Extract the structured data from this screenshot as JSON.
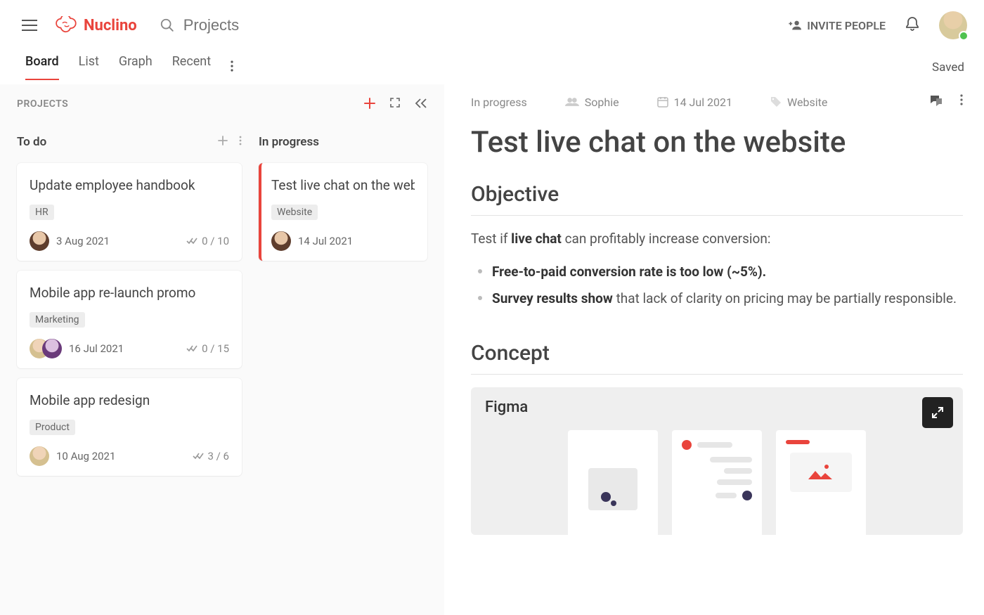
{
  "header": {
    "brand": "Nuclino",
    "search_placeholder": "Projects",
    "invite_label": "INVITE PEOPLE",
    "saved_status": "Saved"
  },
  "view_tabs": {
    "items": [
      "Board",
      "List",
      "Graph",
      "Recent"
    ],
    "active_index": 0
  },
  "board": {
    "title": "PROJECTS",
    "columns": [
      {
        "name": "To do",
        "cards": [
          {
            "title": "Update employee handbook",
            "tag": "HR",
            "date": "3 Aug 2021",
            "progress": "0 / 10"
          },
          {
            "title": "Mobile app re-launch promo",
            "tag": "Marketing",
            "date": "16 Jul 2021",
            "progress": "0 / 15"
          },
          {
            "title": "Mobile app redesign",
            "tag": "Product",
            "date": "10 Aug 2021",
            "progress": "3 / 6"
          }
        ]
      },
      {
        "name": "In progress",
        "cards": [
          {
            "title": "Test live chat on the web",
            "tag": "Website",
            "date": "14 Jul 2021"
          }
        ]
      }
    ]
  },
  "detail": {
    "meta": {
      "status": "In progress",
      "assignee": "Sophie",
      "date": "14 Jul 2021",
      "tag": "Website"
    },
    "title": "Test live chat on the website",
    "sections": {
      "objective": {
        "heading": "Objective",
        "intro_prefix": "Test if ",
        "intro_bold": "live chat",
        "intro_suffix": " can profitably increase conversion:",
        "bullets": [
          {
            "bold": "Free-to-paid conversion rate is too low (~5%)."
          },
          {
            "bold": "Survey results show",
            "rest": " that lack of clarity on pricing may be partially responsible."
          }
        ]
      },
      "concept": {
        "heading": "Concept",
        "embed_title": "Figma"
      }
    }
  }
}
